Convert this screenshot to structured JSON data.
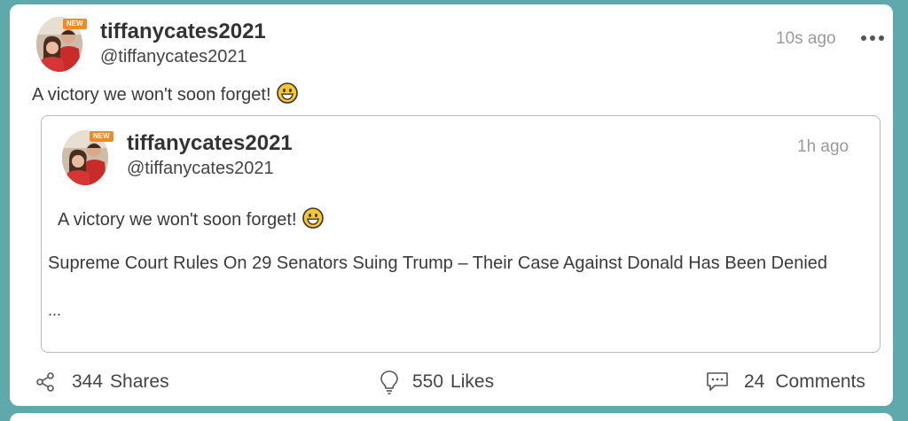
{
  "post": {
    "username": "tiffanycates2021",
    "handle": "@tiffanycates2021",
    "time": "10s ago",
    "avatar_badge": "NEW",
    "text": "A victory we won't soon forget!",
    "text_emoji": "grinning-face-emoji"
  },
  "quoted": {
    "username": "tiffanycates2021",
    "handle": "@tiffanycates2021",
    "time": "1h ago",
    "avatar_badge": "NEW",
    "text": "A victory we won't soon forget!",
    "headline": "Supreme Court Rules On 29 Senators Suing Trump – Their Case Against Donald Has Been Denied",
    "ellipsis": "..."
  },
  "actions": {
    "shares_count": "344",
    "shares_label": "Shares",
    "likes_count": "550",
    "likes_label": "Likes",
    "comments_count": "24",
    "comments_label": "Comments"
  },
  "colors": {
    "background": "#5fa8ac",
    "card": "#ffffff",
    "badge": "#f08a24",
    "muted_text": "#9a9a9a"
  }
}
